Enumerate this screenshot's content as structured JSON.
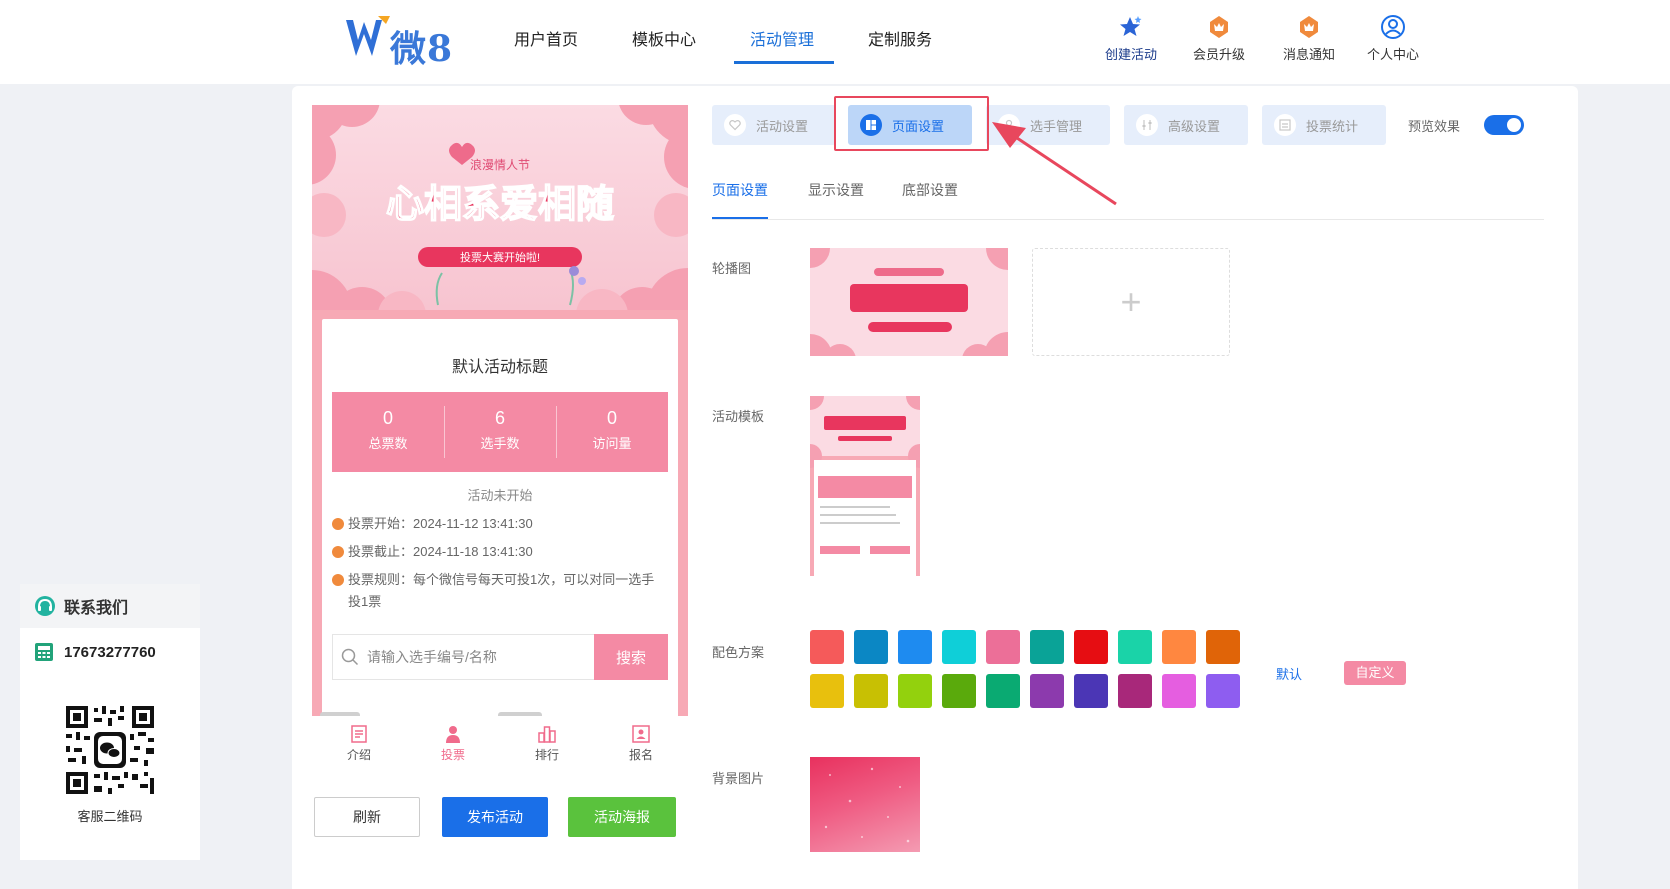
{
  "header": {
    "logo_text": "微8",
    "nav": [
      {
        "label": "用户首页"
      },
      {
        "label": "模板中心"
      },
      {
        "label": "活动管理",
        "active": true
      },
      {
        "label": "定制服务"
      }
    ],
    "tools": [
      {
        "label": "创建活动",
        "icon": "star-icon"
      },
      {
        "label": "会员升级",
        "icon": "crown-icon"
      },
      {
        "label": "消息通知",
        "icon": "bell-icon"
      },
      {
        "label": "个人中心",
        "icon": "user-circle-icon"
      }
    ]
  },
  "contact": {
    "title": "联系我们",
    "phone": "17673277760",
    "qr_caption": "客服二维码"
  },
  "preview": {
    "banner": {
      "small_title": "浪漫情人节",
      "big_title": "心相系爱相随",
      "pill": "投票大赛开始啦!"
    },
    "card_title": "默认活动标题",
    "stats": [
      {
        "value": "0",
        "label": "总票数"
      },
      {
        "value": "6",
        "label": "选手数"
      },
      {
        "value": "0",
        "label": "访问量"
      }
    ],
    "status": "活动未开始",
    "info": [
      {
        "text": "投票开始：2024-11-12 13:41:30"
      },
      {
        "text": "投票截止：2024-11-18 13:41:30"
      },
      {
        "text": "投票规则：每个微信号每天可投1次，可以对同一选手投1票"
      }
    ],
    "search_placeholder": "请输入选手编号/名称",
    "search_button": "搜索",
    "bottom_tabs": [
      {
        "label": "介绍",
        "icon": "document-icon"
      },
      {
        "label": "投票",
        "icon": "person-icon",
        "active": true
      },
      {
        "label": "排行",
        "icon": "ranking-icon"
      },
      {
        "label": "报名",
        "icon": "id-card-icon"
      }
    ]
  },
  "actions": {
    "refresh": "刷新",
    "publish": "发布活动",
    "poster": "活动海报"
  },
  "settings": {
    "tabs": [
      {
        "label": "活动设置",
        "icon": "heart-icon"
      },
      {
        "label": "页面设置",
        "icon": "layout-icon",
        "active": true
      },
      {
        "label": "选手管理",
        "icon": "user-icon"
      },
      {
        "label": "高级设置",
        "icon": "sliders-icon"
      },
      {
        "label": "投票统计",
        "icon": "chart-icon"
      }
    ],
    "preview_label": "预览效果",
    "preview_on": true,
    "subtabs": [
      {
        "label": "页面设置",
        "active": true
      },
      {
        "label": "显示设置"
      },
      {
        "label": "底部设置"
      }
    ],
    "rows": {
      "carousel": "轮播图",
      "template": "活动模板",
      "color_scheme": "配色方案",
      "background": "背景图片"
    },
    "swatches": [
      "#f55a5a",
      "#0b87c4",
      "#1e8bf0",
      "#0fcfd8",
      "#ec6f98",
      "#0aa397",
      "#e60d12",
      "#1ad3a8",
      "#ff8740",
      "#e06408",
      "#e8c00d",
      "#c8c003",
      "#93d10d",
      "#5aaa0c",
      "#0aaa72",
      "#8c3aad",
      "#4b36b5",
      "#a8287a",
      "#e55ee0",
      "#8e5df0"
    ],
    "scheme_default": "默认",
    "scheme_custom": "自定义",
    "accent": "#1a6fe8",
    "highlight": "#e8475d"
  }
}
